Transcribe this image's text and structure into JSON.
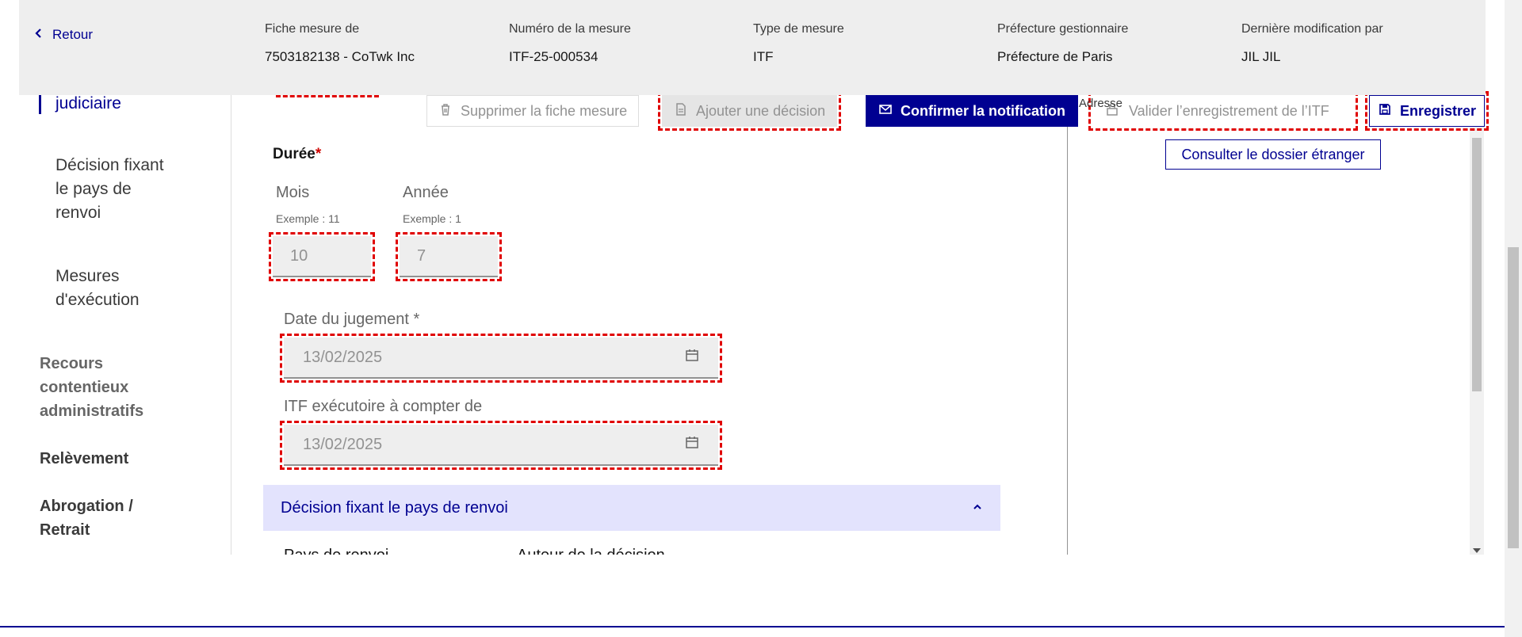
{
  "header": {
    "back_label": "Retour",
    "fields": [
      {
        "label": "Fiche mesure de",
        "value": "7503182138 - CoTwk Inc"
      },
      {
        "label": "Numéro de la mesure",
        "value": "ITF-25-000534"
      },
      {
        "label": "Type de mesure",
        "value": "ITF"
      },
      {
        "label": "Préfecture gestionnaire",
        "value": "Préfecture de Paris"
      },
      {
        "label": "Dernière modification par",
        "value": "JIL JIL"
      }
    ]
  },
  "sidebar": {
    "active_item": "judiciaire",
    "sub_items": [
      "Décision fixant le pays de renvoi",
      "Mesures d'exécution"
    ],
    "sections": [
      "Recours contentieux administratifs",
      "Relèvement",
      "Abrogation / Retrait"
    ]
  },
  "actions": {
    "delete_label": "Supprimer la fiche mesure",
    "add_decision_label": "Ajouter une décision",
    "confirm_label": "Confirmer la notification",
    "adresse_label": "Adresse",
    "validate_label": "Valider l’enregistrement de l’ITF",
    "save_label": "Enregistrer",
    "consult_label": "Consulter le dossier étranger"
  },
  "form": {
    "duree_title": "Durée",
    "required_mark": "*",
    "mois": {
      "label": "Mois",
      "hint": "Exemple : 11",
      "value": "10"
    },
    "annee": {
      "label": "Année",
      "hint": "Exemple : 1",
      "value": "7"
    },
    "date_jugement": {
      "label": "Date du jugement *",
      "value": "13/02/2025"
    },
    "itf_executoire": {
      "label": "ITF exécutoire à compter de",
      "value": "13/02/2025"
    },
    "accordion_title": "Décision fixant le pays de renvoi",
    "cut_left": "Pays de renvoi",
    "cut_right": "Auteur de la décision"
  },
  "icons": [
    "chevron-left-icon",
    "trash-icon",
    "document-icon",
    "mail-icon",
    "lock-icon",
    "save-icon",
    "calendar-icon",
    "chevron-up-icon"
  ],
  "colors": {
    "primary": "#000091",
    "required": "#ce0500",
    "accordion_bg": "#e3e3fd",
    "dashed_outline": "#e00000"
  }
}
